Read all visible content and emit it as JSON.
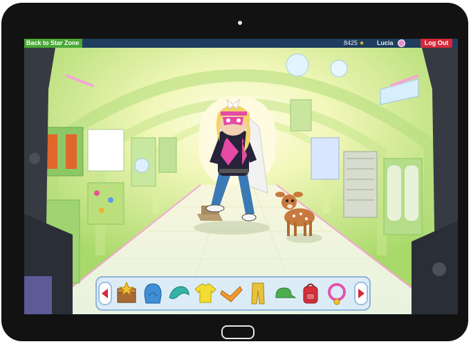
{
  "topbar": {
    "back_label": "Back to Star Zone",
    "star_count": "8425",
    "star_icon": "star-icon",
    "username": "Lucia",
    "logout_label": "Log Out"
  },
  "scene": {
    "location": "spaceship corridor",
    "character": "superhero girl with pink mask and cape",
    "pet": "baby deer"
  },
  "items": [
    {
      "name": "treasure-chest-icon"
    },
    {
      "name": "blue-hood-icon"
    },
    {
      "name": "hair-icon"
    },
    {
      "name": "yellow-shirt-icon"
    },
    {
      "name": "orange-sleeve-icon"
    },
    {
      "name": "yellow-pants-icon"
    },
    {
      "name": "green-cap-icon"
    },
    {
      "name": "red-backpack-icon"
    },
    {
      "name": "pink-collar-icon"
    }
  ],
  "colors": {
    "topbar": "#1f3d5f",
    "back_button": "#49a836",
    "logout_button": "#d6293b",
    "corridor": "#d9ec9a"
  }
}
